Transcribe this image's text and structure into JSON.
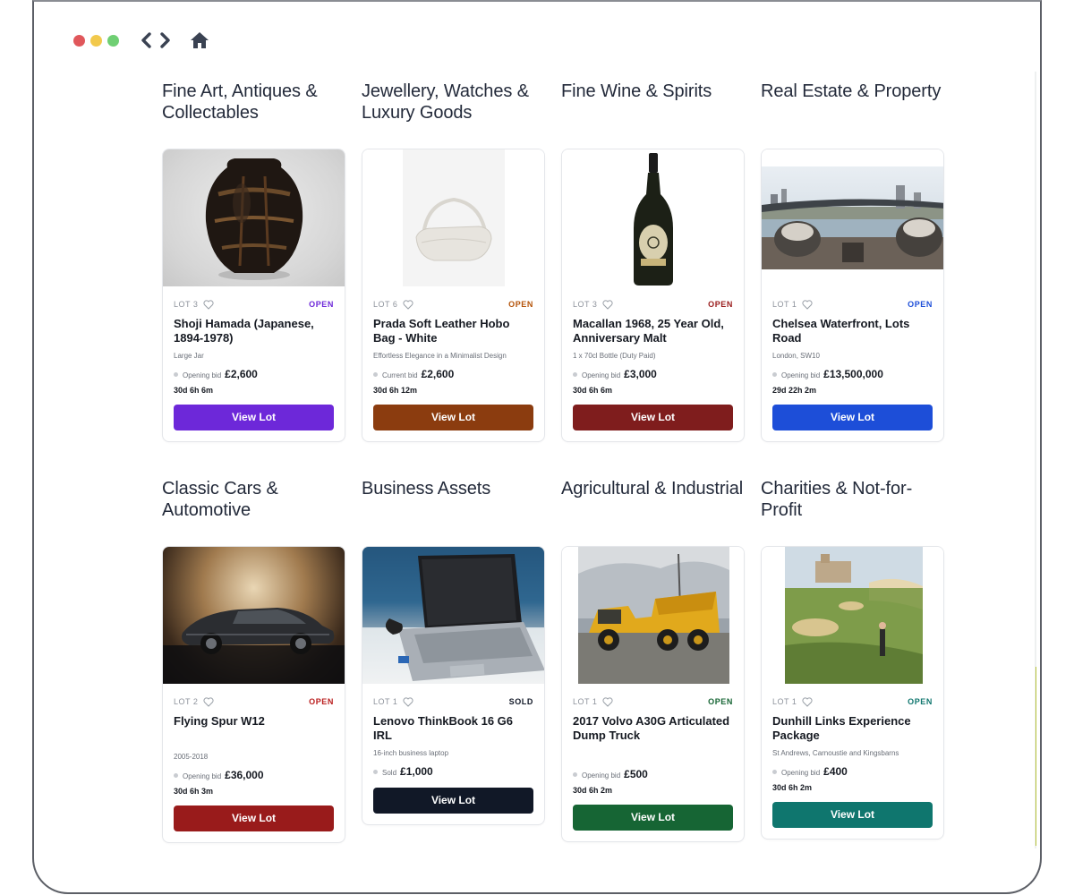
{
  "browser": {
    "controls": [
      "close",
      "minimize",
      "maximize"
    ],
    "dot_colors": [
      "#e0575b",
      "#f2c94c",
      "#6fcf73"
    ],
    "back_icon": "chevron-left-icon",
    "forward_icon": "chevron-right-icon",
    "home_icon": "home-icon"
  },
  "categories": [
    {
      "heading": "Fine Art, Antiques & Collectables",
      "accent": "#6d28d9",
      "lot": {
        "number": "LOT 3",
        "status": "OPEN",
        "title": "Shoji Hamada (Japanese, 1894-1978)",
        "subtitle": "Large Jar",
        "bid_label": "Opening bid",
        "bid_amount": "£2,600",
        "time_left": "30d 6h 6m",
        "button": "View Lot"
      }
    },
    {
      "heading": "Jewellery, Watches & Luxury Goods",
      "accent": "#8b3c0f",
      "lot": {
        "number": "LOT 6",
        "status": "OPEN",
        "title": "Prada Soft Leather Hobo Bag - White",
        "subtitle": "Effortless Elegance in a Minimalist Design",
        "bid_label": "Current bid",
        "bid_amount": "£2,600",
        "time_left": "30d 6h 12m",
        "button": "View Lot"
      }
    },
    {
      "heading": "Fine Wine & Spirits",
      "accent": "#7f1d1d",
      "lot": {
        "number": "LOT 3",
        "status": "OPEN",
        "title": "Macallan 1968, 25 Year Old, Anniversary Malt",
        "subtitle": "1 x 70cl Bottle (Duty Paid)",
        "bid_label": "Opening bid",
        "bid_amount": "£3,000",
        "time_left": "30d 6h 6m",
        "button": "View Lot"
      }
    },
    {
      "heading": "Real Estate & Property",
      "accent": "#1d4ed8",
      "lot": {
        "number": "LOT 1",
        "status": "OPEN",
        "title": "Chelsea Waterfront, Lots Road",
        "subtitle": "London, SW10",
        "bid_label": "Opening bid",
        "bid_amount": "£13,500,000",
        "time_left": "29d 22h 2m",
        "button": "View Lot"
      }
    },
    {
      "heading": "Classic Cars & Automotive",
      "accent": "#991b1b",
      "lot": {
        "number": "LOT 2",
        "status": "OPEN",
        "title": "Flying Spur W12",
        "subtitle": "2005-2018",
        "bid_label": "Opening bid",
        "bid_amount": "£36,000",
        "time_left": "30d 6h 3m",
        "button": "View Lot"
      }
    },
    {
      "heading": "Business Assets",
      "accent": "#111827",
      "lot": {
        "number": "LOT 1",
        "status": "SOLD",
        "title": "Lenovo ThinkBook 16 G6 IRL",
        "subtitle": "16-inch business laptop",
        "bid_label": "Sold",
        "bid_amount": "£1,000",
        "time_left": "",
        "button": "View Lot"
      }
    },
    {
      "heading": "Agricultural & Industrial",
      "accent": "#166534",
      "lot": {
        "number": "LOT 1",
        "status": "OPEN",
        "title": "2017 Volvo A30G Articulated Dump Truck",
        "subtitle": "",
        "bid_label": "Opening bid",
        "bid_amount": "£500",
        "time_left": "30d 6h 2m",
        "button": "View Lot"
      }
    },
    {
      "heading": "Charities & Not-for-Profit",
      "accent": "#0f766e",
      "lot": {
        "number": "LOT 1",
        "status": "OPEN",
        "title": "Dunhill Links Experience Package",
        "subtitle": "St Andrews, Carnoustie and Kingsbarns",
        "bid_label": "Opening bid",
        "bid_amount": "£400",
        "time_left": "30d 6h 2m",
        "button": "View Lot"
      }
    }
  ]
}
